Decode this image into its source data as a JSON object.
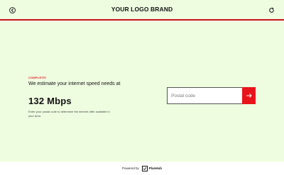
{
  "header": {
    "brand": "YOUR LOGO BRAND",
    "back_icon": "back-arrow-circle-icon",
    "refresh_icon": "refresh-icon"
  },
  "result": {
    "status": "COMPLETE!",
    "estimate_text": "We estimate your internet speed needs at",
    "speed": "132 Mbps",
    "helper_text": "Enter your postal code to determine the internet offer available in your area."
  },
  "postal": {
    "placeholder": "Postal code",
    "value": "",
    "submit_icon": "arrow-right-icon"
  },
  "footer": {
    "powered_by": "Powered by",
    "logo_name": "PlanHub"
  },
  "colors": {
    "background": "#eefde0",
    "accent": "#e8141b",
    "header_rule": "#c9151b"
  }
}
